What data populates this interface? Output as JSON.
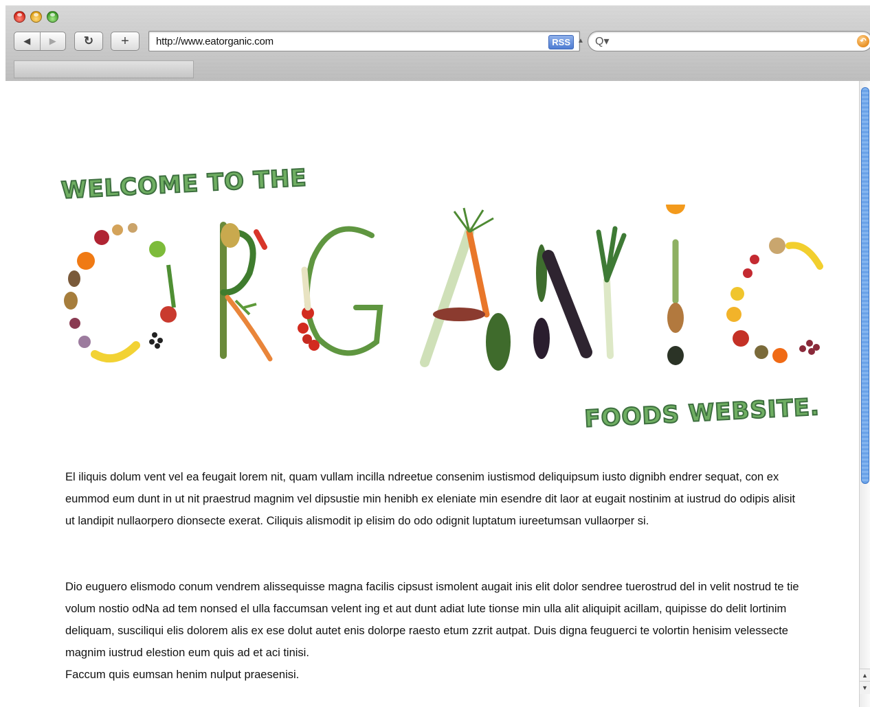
{
  "browser": {
    "url": "http://www.eatorganic.com",
    "rss_label": "RSS",
    "back_glyph": "◀",
    "forward_glyph": "▶",
    "reload_glyph": "↻",
    "add_bookmark_glyph": "+",
    "search_glyph": "Q▾",
    "snapback_glyph": "↶",
    "accent": "#4f7dd3"
  },
  "page": {
    "welcome_text": "Welcome to the",
    "organic_logo_text": "ORGANIC",
    "foods_text": "Foods website.",
    "heading_color": "#6fae62",
    "paragraphs": [
      "El iliquis dolum vent vel ea feugait lorem nit, quam vullam incilla ndreetue consenim iustismod deliquipsum iusto dignibh endrer sequat, con ex eummod eum dunt in ut nit praestrud magnim vel dipsustie min henibh ex eleniate min esendre dit laor at eugait nostinim at iustrud do odipis alisit ut landipit nullaorpero dionsecte exerat. Ciliquis alismodit ip elisim do odo odignit luptatum iureetumsan vullaorper si.",
      "Dio euguero elismodo conum vendrem alissequisse magna facilis cipsust ismolent augait inis elit dolor sendree tuerostrud del in velit nostrud te tie volum nostio odNa ad tem nonsed el ulla faccumsan velent ing et aut dunt adiat lute tionse min ulla alit aliquipit acillam, quipisse do delit lortinim deliquam, susciliqui elis dolorem alis ex ese dolut autet enis dolorpe raesto etum zzrit autpat. Duis digna feuguerci te volortin henisim velessecte magnim iustrud elestion eum quis ad et aci tinisi.",
      "Faccum quis eumsan henim nulput praesenisi."
    ]
  },
  "scrollbar": {
    "up_glyph": "▲",
    "down_glyph": "▼"
  }
}
